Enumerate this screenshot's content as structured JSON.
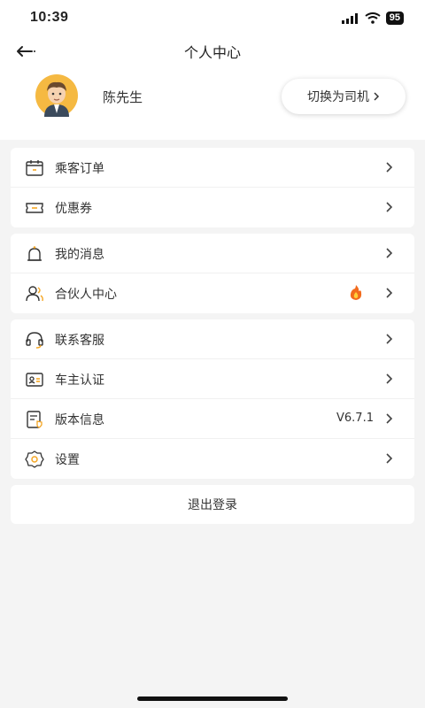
{
  "status": {
    "time": "10:39",
    "battery": "95"
  },
  "nav": {
    "title": "个人中心"
  },
  "profile": {
    "name": "陈先生",
    "switch_label": "切换为司机"
  },
  "groups": [
    [
      {
        "label": "乘客订单",
        "icon": "calendar-icon"
      },
      {
        "label": "优惠券",
        "icon": "ticket-icon"
      }
    ],
    [
      {
        "label": "我的消息",
        "icon": "bell-icon"
      },
      {
        "label": "合伙人中心",
        "icon": "partner-icon",
        "badge": "fire-icon"
      }
    ],
    [
      {
        "label": "联系客服",
        "icon": "headset-icon"
      },
      {
        "label": "车主认证",
        "icon": "id-card-icon"
      },
      {
        "label": "版本信息",
        "icon": "info-doc-icon",
        "value": "V6.7.1"
      },
      {
        "label": "设置",
        "icon": "gear-icon"
      }
    ]
  ],
  "logout_label": "退出登录",
  "colors": {
    "accent": "#f5a623",
    "background": "#f4f4f4"
  }
}
